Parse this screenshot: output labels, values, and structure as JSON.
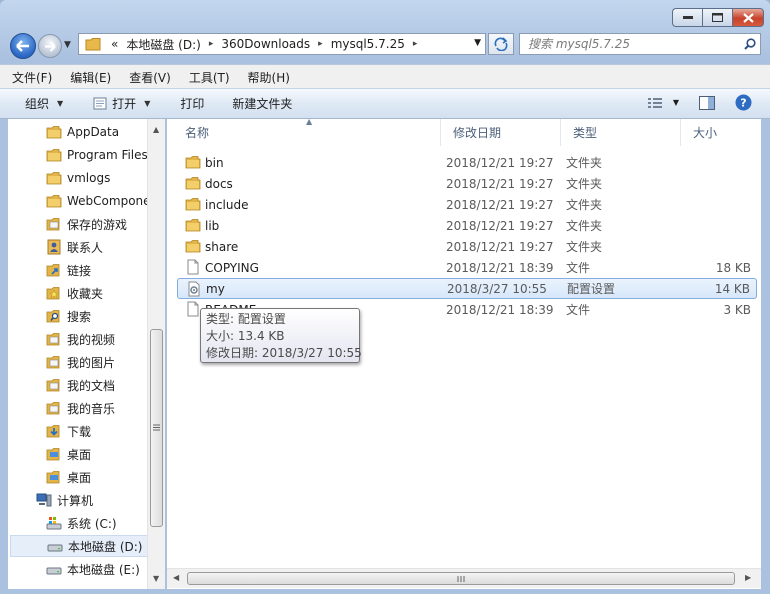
{
  "breadcrumb": {
    "overflow": "«",
    "items": [
      "本地磁盘 (D:)",
      "360Downloads",
      "mysql5.7.25"
    ]
  },
  "search": {
    "placeholder": "搜索 mysql5.7.25"
  },
  "menu": [
    "文件(F)",
    "编辑(E)",
    "查看(V)",
    "工具(T)",
    "帮助(H)"
  ],
  "toolbar": {
    "organize": "组织",
    "open": "打开",
    "print": "打印",
    "new_folder": "新建文件夹"
  },
  "nav": [
    {
      "label": "AppData",
      "icon": "folder-icon"
    },
    {
      "label": "Program Files",
      "icon": "folder-icon"
    },
    {
      "label": "vmlogs",
      "icon": "folder-icon"
    },
    {
      "label": "WebComponents",
      "icon": "folder-icon"
    },
    {
      "label": "保存的游戏",
      "icon": "saved-games-icon"
    },
    {
      "label": "联系人",
      "icon": "contacts-icon"
    },
    {
      "label": "链接",
      "icon": "links-icon"
    },
    {
      "label": "收藏夹",
      "icon": "favorites-icon"
    },
    {
      "label": "搜索",
      "icon": "searches-icon"
    },
    {
      "label": "我的视频",
      "icon": "videos-icon"
    },
    {
      "label": "我的图片",
      "icon": "pictures-icon"
    },
    {
      "label": "我的文档",
      "icon": "documents-icon"
    },
    {
      "label": "我的音乐",
      "icon": "music-icon"
    },
    {
      "label": "下载",
      "icon": "downloads-icon"
    },
    {
      "label": "桌面",
      "icon": "desktop-icon"
    },
    {
      "label": "桌面",
      "icon": "desktop-icon"
    },
    {
      "label": "计算机",
      "icon": "computer-icon"
    },
    {
      "label": "系统 (C:)",
      "icon": "system-drive-icon"
    },
    {
      "label": "本地磁盘 (D:)",
      "icon": "drive-icon"
    },
    {
      "label": "本地磁盘 (E:)",
      "icon": "drive-icon"
    }
  ],
  "columns": {
    "name": "名称",
    "date": "修改日期",
    "type": "类型",
    "size": "大小"
  },
  "files": [
    {
      "name": "bin",
      "date": "2018/12/21 19:27",
      "type": "文件夹",
      "size": "",
      "icon": "folder-icon"
    },
    {
      "name": "docs",
      "date": "2018/12/21 19:27",
      "type": "文件夹",
      "size": "",
      "icon": "folder-icon"
    },
    {
      "name": "include",
      "date": "2018/12/21 19:27",
      "type": "文件夹",
      "size": "",
      "icon": "folder-icon"
    },
    {
      "name": "lib",
      "date": "2018/12/21 19:27",
      "type": "文件夹",
      "size": "",
      "icon": "folder-icon"
    },
    {
      "name": "share",
      "date": "2018/12/21 19:27",
      "type": "文件夹",
      "size": "",
      "icon": "folder-icon"
    },
    {
      "name": "COPYING",
      "date": "2018/12/21 18:39",
      "type": "文件",
      "size": "18 KB",
      "icon": "file-icon"
    },
    {
      "name": "my",
      "date": "2018/3/27 10:55",
      "type": "配置设置",
      "size": "14 KB",
      "icon": "config-file-icon"
    },
    {
      "name": "README",
      "date": "2018/12/21 18:39",
      "type": "文件",
      "size": "3 KB",
      "icon": "file-icon"
    }
  ],
  "tooltip": {
    "type": "类型: 配置设置",
    "size": "大小: 13.4 KB",
    "date": "修改日期: 2018/3/27 10:55"
  }
}
